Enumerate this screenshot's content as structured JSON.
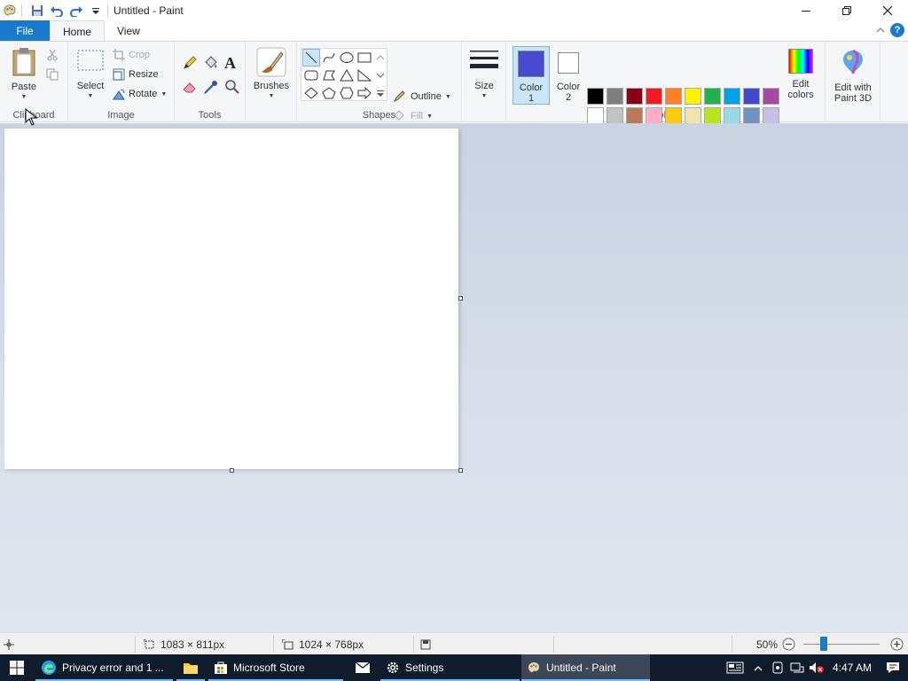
{
  "window": {
    "title": "Untitled - Paint"
  },
  "tabs": {
    "file": "File",
    "home": "Home",
    "view": "View"
  },
  "groups": {
    "clipboard": {
      "label": "Clipboard",
      "paste": "Paste"
    },
    "image": {
      "label": "Image",
      "select": "Select",
      "crop": "Crop",
      "resize": "Resize",
      "rotate": "Rotate"
    },
    "tools": {
      "label": "Tools"
    },
    "brushes": {
      "label": "Brushes"
    },
    "shapes": {
      "label": "Shapes",
      "outline": "Outline",
      "fill": "Fill"
    },
    "size": {
      "label": "Size"
    },
    "colors": {
      "label": "Colors",
      "color1_line1": "Color",
      "color1_line2": "1",
      "color2_line1": "Color",
      "color2_line2": "2",
      "edit_line1": "Edit",
      "edit_line2": "colors",
      "color1_value": "#4a4ad0",
      "color2_value": "#ffffff",
      "row1": [
        "#000000",
        "#7f7f7f",
        "#880015",
        "#ed1c24",
        "#ff7f27",
        "#fff200",
        "#22b14c",
        "#00a2e8",
        "#3f48cc",
        "#a349a4"
      ],
      "row2": [
        "#ffffff",
        "#c3c3c3",
        "#b97a57",
        "#ffaec9",
        "#ffc90e",
        "#efe4b0",
        "#b5e61d",
        "#99d9ea",
        "#7092be",
        "#c8bfe7"
      ]
    },
    "paint3d": {
      "line1": "Edit with",
      "line2": "Paint 3D"
    }
  },
  "status": {
    "selection_size": "1083 × 811px",
    "image_size": "1024 × 768px",
    "zoom": "50%"
  },
  "taskbar": {
    "edge": "Privacy error and 1 ...",
    "store": "Microsoft Store",
    "settings": "Settings",
    "paint": "Untitled - Paint",
    "time": "4:47 AM"
  }
}
